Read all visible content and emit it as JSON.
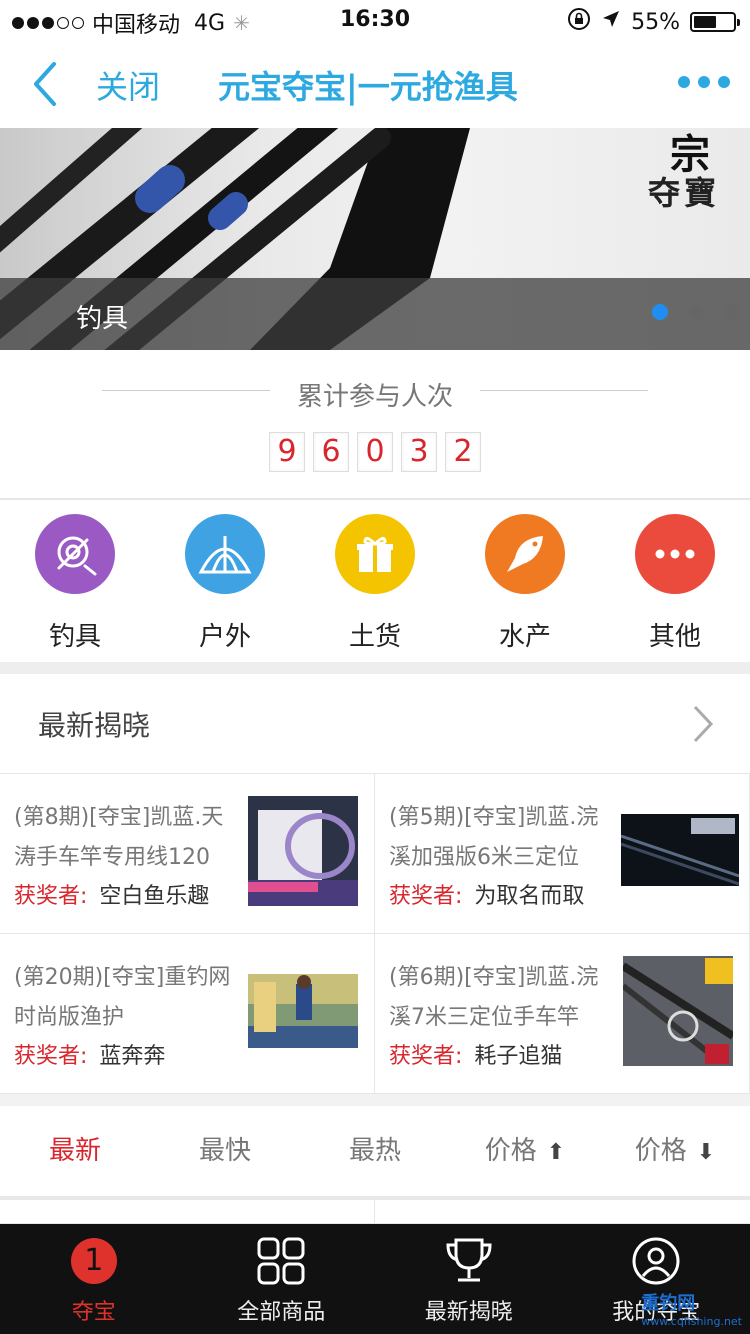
{
  "status_bar": {
    "carrier": "中国移动",
    "network": "4G",
    "time": "16:30",
    "battery": "55%"
  },
  "nav": {
    "close_label": "关闭",
    "title": "元宝夺宝|一元抢渔具"
  },
  "banner": {
    "caption": "钓具",
    "watermark_text": "夺寶",
    "slides": 3,
    "active_slide": 1
  },
  "participants": {
    "title": "累计参与人次",
    "digits": [
      "9",
      "6",
      "0",
      "3",
      "2"
    ]
  },
  "categories": [
    {
      "label": "钓具",
      "color": "#9b59c4",
      "icon": "fishing-reel-icon"
    },
    {
      "label": "户外",
      "color": "#3fa3e3",
      "icon": "tent-icon"
    },
    {
      "label": "土货",
      "color": "#f5c400",
      "icon": "gift-icon"
    },
    {
      "label": "水产",
      "color": "#f07a22",
      "icon": "fish-icon"
    },
    {
      "label": "其他",
      "color": "#ea4b3c",
      "icon": "more-dots-icon"
    }
  ],
  "latest": {
    "title": "最新揭晓",
    "winner_label": "获奖者:",
    "items": [
      {
        "title": "(第8期)[夺宝]凯蓝.天涛手车竿专用线120",
        "winner": "空白鱼乐趣"
      },
      {
        "title": "(第5期)[夺宝]凯蓝.浣溪加强版6米三定位",
        "winner": "为取名而取"
      },
      {
        "title": "(第20期)[夺宝]重钓网时尚版渔护",
        "winner": "蓝奔奔"
      },
      {
        "title": "(第6期)[夺宝]凯蓝.浣溪7米三定位手车竿",
        "winner": "耗子追猫"
      }
    ]
  },
  "sort_tabs": [
    {
      "label": "最新",
      "arrow": ""
    },
    {
      "label": "最快",
      "arrow": ""
    },
    {
      "label": "最热",
      "arrow": ""
    },
    {
      "label": "价格",
      "arrow": "⬆"
    },
    {
      "label": "价格",
      "arrow": "⬇"
    }
  ],
  "tabbar": {
    "items": [
      {
        "label": "夺宝",
        "badge": "1"
      },
      {
        "label": "全部商品"
      },
      {
        "label": "最新揭晓"
      },
      {
        "label": "我的夺宝"
      }
    ]
  },
  "watermark": {
    "name": "重钓网",
    "url": "www.cqfishing.net"
  },
  "colors": {
    "accent_blue": "#2da9e1",
    "accent_red": "#d8262c"
  }
}
